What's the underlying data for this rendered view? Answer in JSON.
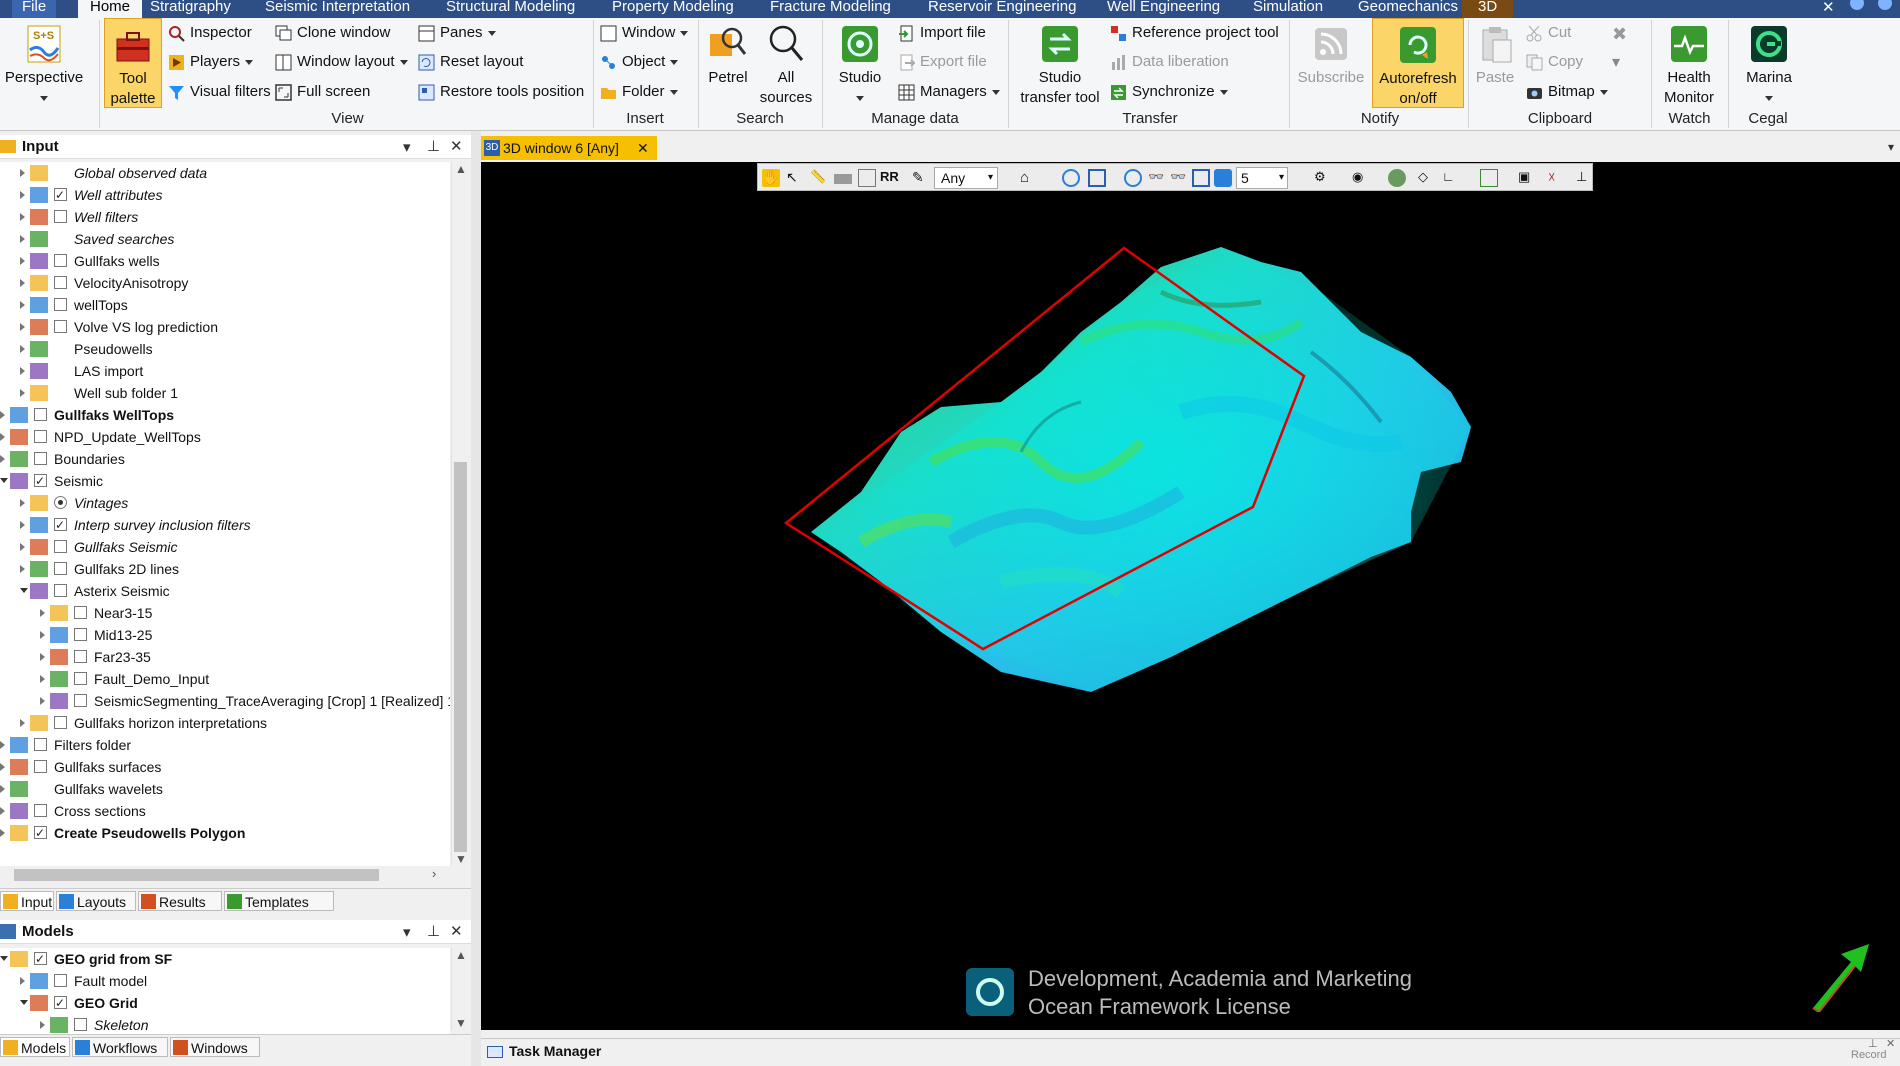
{
  "ribbon_tabs": [
    "File",
    "Home",
    "Stratigraphy",
    "Seismic Interpretation",
    "Structural Modeling",
    "Property Modeling",
    "Fracture Modeling",
    "Reservoir Engineering",
    "Well Engineering",
    "Simulation",
    "Geomechanics",
    "3D"
  ],
  "ribbon": {
    "perspective": "Perspective",
    "tool_palette": [
      "Tool",
      "palette"
    ],
    "inspector": "Inspector",
    "players": "Players",
    "visual_filters": "Visual filters",
    "clone_window": "Clone window",
    "window_layout": "Window layout",
    "full_screen": "Full screen",
    "panes": "Panes",
    "reset_layout": "Reset layout",
    "restore_tools": "Restore tools position",
    "view_label": "View",
    "window": "Window",
    "object": "Object",
    "folder": "Folder",
    "insert_label": "Insert",
    "petrel": "Petrel",
    "all_sources": [
      "All",
      "sources"
    ],
    "search_label": "Search",
    "studio": "Studio",
    "import_file": "Import file",
    "export_file": "Export file",
    "managers": "Managers",
    "manage_label": "Manage data",
    "studio_transfer": [
      "Studio",
      "transfer tool"
    ],
    "reference_project": "Reference project tool",
    "data_liberation": "Data liberation",
    "synchronize": "Synchronize",
    "transfer_label": "Transfer",
    "subscribe": "Subscribe",
    "autorefresh": [
      "Autorefresh",
      "on/off"
    ],
    "notify_label": "Notify",
    "paste": "Paste",
    "cut": "Cut",
    "copy": "Copy",
    "bitmap": "Bitmap",
    "clipboard_label": "Clipboard",
    "health_monitor": [
      "Health",
      "Monitor"
    ],
    "watch_label": "Watch",
    "marina": "Marina",
    "cegal_label": "Cegal"
  },
  "input_pane": {
    "title": "Input",
    "items": [
      {
        "label": "Global observed data",
        "style": "it",
        "level": 2,
        "cb": "none"
      },
      {
        "label": "Well attributes",
        "style": "it",
        "level": 2,
        "cb": "on"
      },
      {
        "label": "Well filters",
        "style": "it",
        "level": 2,
        "cb": "off"
      },
      {
        "label": "Saved searches",
        "style": "it",
        "level": 2,
        "cb": "none"
      },
      {
        "label": "Gullfaks wells",
        "style": "",
        "level": 2,
        "cb": "off"
      },
      {
        "label": "VelocityAnisotropy",
        "style": "",
        "level": 2,
        "cb": "off"
      },
      {
        "label": "wellTops",
        "style": "",
        "level": 2,
        "cb": "off"
      },
      {
        "label": "Volve VS log prediction",
        "style": "",
        "level": 2,
        "cb": "off"
      },
      {
        "label": "Pseudowells",
        "style": "",
        "level": 2,
        "cb": "none"
      },
      {
        "label": "LAS import",
        "style": "",
        "level": 2,
        "cb": "none"
      },
      {
        "label": "Well sub folder 1",
        "style": "",
        "level": 2,
        "cb": "none"
      },
      {
        "label": "Gullfaks WellTops",
        "style": "bd",
        "level": 1,
        "cb": "off"
      },
      {
        "label": "NPD_Update_WellTops",
        "style": "",
        "level": 1,
        "cb": "off"
      },
      {
        "label": "Boundaries",
        "style": "",
        "level": 1,
        "cb": "off"
      },
      {
        "label": "Seismic",
        "style": "",
        "level": 1,
        "cb": "on"
      },
      {
        "label": "Vintages",
        "style": "it",
        "level": 2,
        "cb": "rad"
      },
      {
        "label": "Interp survey inclusion filters",
        "style": "it",
        "level": 2,
        "cb": "on"
      },
      {
        "label": "Gullfaks Seismic",
        "style": "it",
        "level": 2,
        "cb": "off"
      },
      {
        "label": "Gullfaks 2D lines",
        "style": "",
        "level": 2,
        "cb": "off"
      },
      {
        "label": "Asterix Seismic",
        "style": "",
        "level": 2,
        "cb": "off"
      },
      {
        "label": "Near3-15",
        "style": "",
        "level": 3,
        "cb": "off"
      },
      {
        "label": "Mid13-25",
        "style": "",
        "level": 3,
        "cb": "off"
      },
      {
        "label": "Far23-35",
        "style": "",
        "level": 3,
        "cb": "off"
      },
      {
        "label": "Fault_Demo_Input",
        "style": "",
        "level": 3,
        "cb": "off"
      },
      {
        "label": "SeismicSegmenting_TraceAveraging [Crop] 1 [Realized] 1",
        "style": "",
        "level": 3,
        "cb": "off"
      },
      {
        "label": "Gullfaks horizon interpretations",
        "style": "",
        "level": 2,
        "cb": "off"
      },
      {
        "label": "Filters folder",
        "style": "",
        "level": 1,
        "cb": "off"
      },
      {
        "label": "Gullfaks surfaces",
        "style": "",
        "level": 1,
        "cb": "off"
      },
      {
        "label": "Gullfaks wavelets",
        "style": "",
        "level": 1,
        "cb": "none"
      },
      {
        "label": "Cross sections",
        "style": "",
        "level": 1,
        "cb": "off"
      },
      {
        "label": "Create Pseudowells Polygon",
        "style": "bd",
        "level": 1,
        "cb": "on"
      }
    ],
    "tabs": [
      "Input",
      "Layouts",
      "Results",
      "Templates"
    ]
  },
  "models_pane": {
    "title": "Models",
    "items": [
      {
        "label": "GEO grid from SF",
        "style": "bd",
        "level": 1,
        "cb": "on"
      },
      {
        "label": "Fault model",
        "style": "",
        "level": 2,
        "cb": "off"
      },
      {
        "label": "GEO Grid",
        "style": "bd",
        "level": 2,
        "cb": "on"
      },
      {
        "label": "Skeleton",
        "style": "it",
        "level": 3,
        "cb": "off"
      }
    ],
    "tabs": [
      "Models",
      "Workflows",
      "Windows"
    ]
  },
  "viewport": {
    "tab_label": "3D window 6 [Any]",
    "filter_value": "Any",
    "number_value": "5",
    "watermark_line1": "Development, Academia and Marketing",
    "watermark_line2": "Ocean Framework License"
  },
  "task_manager": "Task Manager",
  "status_text": "Record",
  "colors": {
    "ribbon_tab_bar": "#2d4f86",
    "active_tab": "#f6c000",
    "polygon": "#e00000",
    "surface_cyan": "#20d8e8",
    "surface_green": "#40e060"
  }
}
